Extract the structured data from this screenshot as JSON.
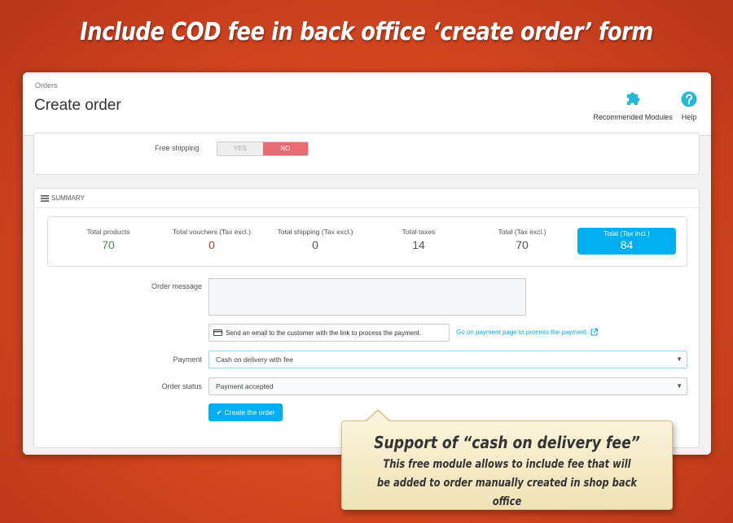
{
  "headline": "Include COD fee in back office ‘create order’ form",
  "header": {
    "breadcrumb": "Orders",
    "title": "Create order",
    "toolbar": {
      "modules_label": "Recommended Modules",
      "modules_icon": "puzzle-icon",
      "help_label": "Help",
      "help_icon": "help-icon"
    }
  },
  "shipping": {
    "free_shipping_label": "Free shipping",
    "yes_label": "YES",
    "no_label": "NO",
    "selected": "NO"
  },
  "summary": {
    "heading": "SUMMARY",
    "totals": [
      {
        "label": "Total products",
        "value": "70"
      },
      {
        "label": "Total vouchers (Tax excl.)",
        "value": "0"
      },
      {
        "label": "Total shipping (Tax excl.)",
        "value": "0"
      },
      {
        "label": "Total taxes",
        "value": "14"
      },
      {
        "label": "Total (Tax excl.)",
        "value": "70"
      },
      {
        "label": "Total (Tax incl.)",
        "value": "84"
      }
    ],
    "order_message_label": "Order message",
    "order_message_value": "",
    "send_email_label": "Send an email to the customer with the link to process the payment.",
    "payment_page_link": "Go on payment page to process the payment.",
    "payment_label": "Payment",
    "payment_value": "Cash on delivery with fee",
    "order_status_label": "Order status",
    "order_status_value": "Payment accepted",
    "create_button": "Create the order"
  },
  "callout": {
    "title": "Support of “cash on delivery fee”",
    "text": "This free module allows to include fee that will be added to order manually created in shop back office"
  },
  "colors": {
    "accent": "#00aff0",
    "no_switch": "#e86b72",
    "background": "#d2451f"
  }
}
